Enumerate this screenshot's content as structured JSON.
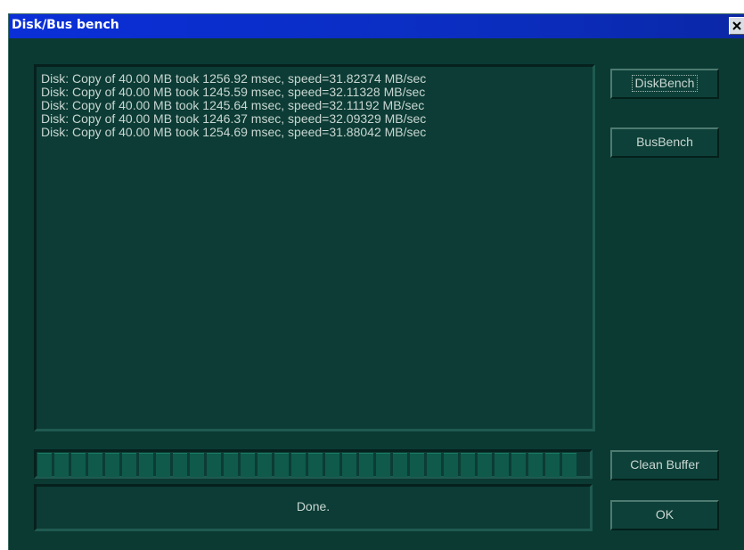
{
  "window": {
    "title": "Disk/Bus bench"
  },
  "log": {
    "lines": [
      "Disk: Copy of 40.00 MB took 1256.92 msec, speed=31.82374 MB/sec",
      "Disk: Copy of 40.00 MB took 1245.59 msec, speed=32.11328 MB/sec",
      "Disk: Copy of 40.00 MB took 1245.64 msec, speed=32.11192 MB/sec",
      "Disk: Copy of 40.00 MB took 1246.37 msec, speed=32.09329 MB/sec",
      "Disk: Copy of 40.00 MB took 1254.69 msec, speed=31.88042 MB/sec"
    ]
  },
  "buttons": {
    "diskbench": "DiskBench",
    "busbench": "BusBench",
    "clean_buffer": "Clean Buffer",
    "ok": "OK"
  },
  "progress": {
    "fraction": 1.0,
    "state": "full"
  },
  "status": {
    "text": "Done."
  },
  "icons": {
    "close": "close-icon"
  },
  "colors": {
    "titlebar": "#0a2fd8",
    "window_bg": "#0b3a33",
    "text": "#c9d6d2"
  }
}
